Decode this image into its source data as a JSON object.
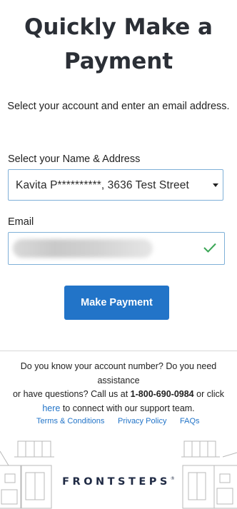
{
  "page": {
    "title_line1": "Quickly Make a",
    "title_line2": "Payment",
    "subtitle": "Select your account and enter an email address."
  },
  "form": {
    "name_label": "Select your Name & Address",
    "name_selected": "Kavita P**********, 3636 Test Street",
    "email_label": "Email",
    "email_valid": true,
    "submit_label": "Make Payment"
  },
  "help": {
    "line1": "Do you know your account number? Do you need assistance",
    "line2_prefix": "or have questions? Call us at ",
    "phone": "1-800-690-0984",
    "line2_suffix": " or click",
    "link_text": "here",
    "line3_suffix": " to connect with our support team."
  },
  "footer": {
    "terms": "Terms & Conditions",
    "privacy": "Privacy Policy",
    "faqs": "FAQs",
    "logo_text": "FRONTSTEPS",
    "logo_mark": "®"
  },
  "colors": {
    "primary": "#2274c8",
    "title": "#2b2f36",
    "input_border": "#7fb0d8",
    "success": "#3aa655"
  }
}
